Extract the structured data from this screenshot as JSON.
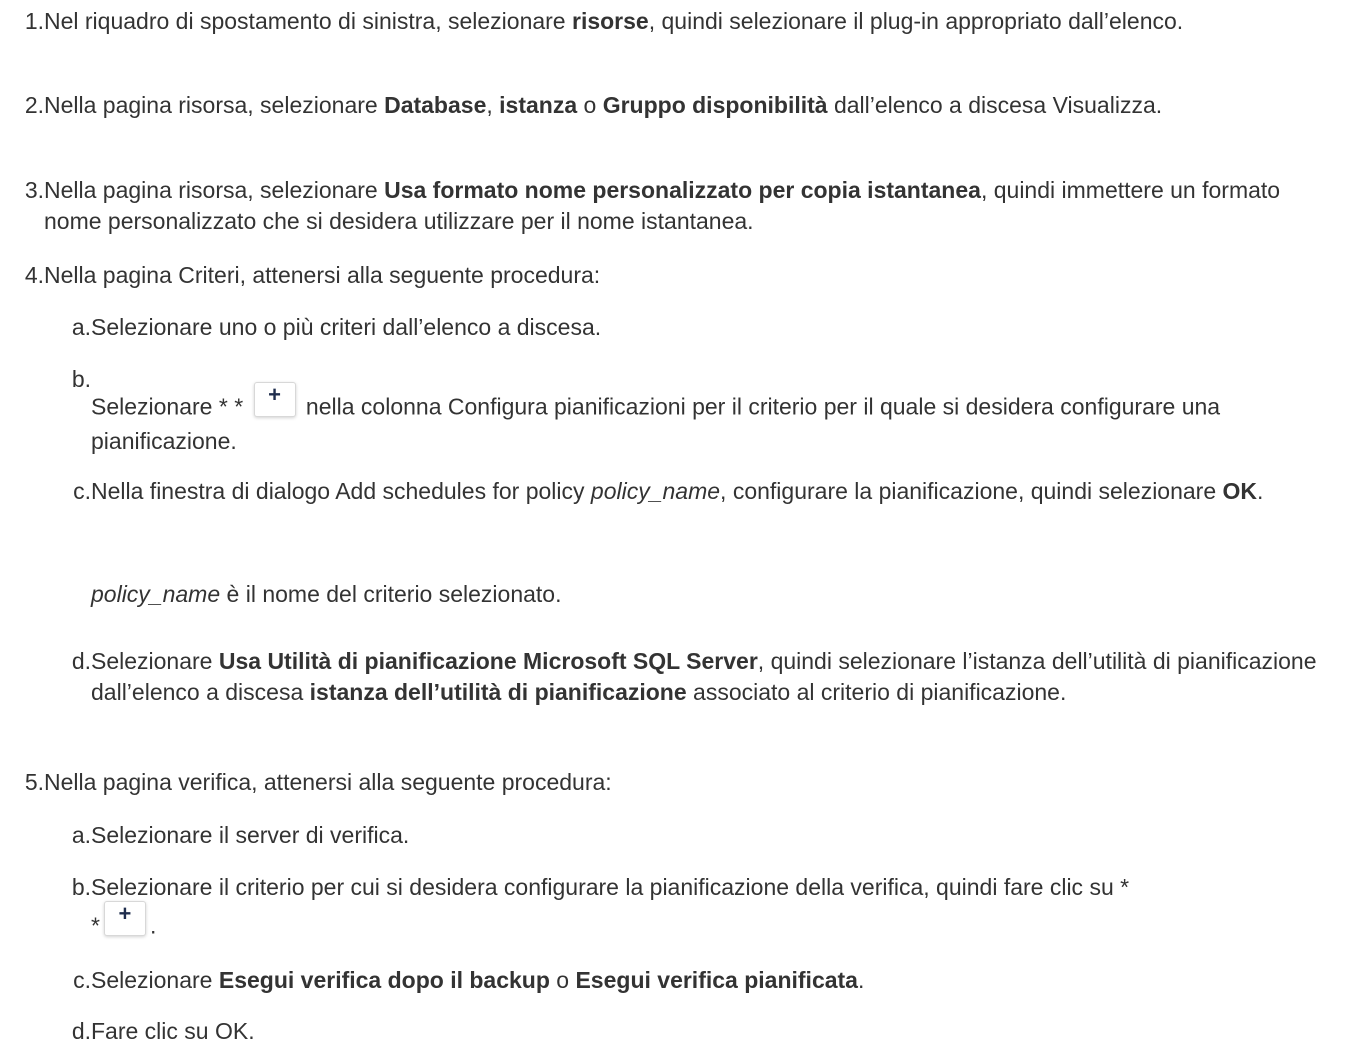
{
  "steps": [
    {
      "num": "1.",
      "parts": [
        "Nel riquadro di spostamento di sinistra, selezionare ",
        "risorse",
        ", quindi selezionare il plug-in appropriato dall’elenco."
      ]
    },
    {
      "num": "2.",
      "parts": [
        "Nella pagina risorsa, selezionare ",
        "Database",
        ", ",
        "istanza",
        " o ",
        "Gruppo disponibilità",
        " dall’elenco a discesa Visualizza."
      ]
    },
    {
      "num": "3.",
      "parts": [
        "Nella pagina risorsa, selezionare ",
        "Usa formato nome personalizzato per copia istantanea",
        ", quindi immettere un formato nome personalizzato che si desidera utilizzare per il nome istantanea."
      ]
    },
    {
      "num": "4.",
      "text": "Nella pagina Criteri, attenersi alla seguente procedura:",
      "substeps": [
        {
          "num": "a.",
          "text": "Selezionare uno o più criteri dall’elenco a discesa."
        },
        {
          "num": "b.",
          "before": "Selezionare * * ",
          "after": " nella colonna Configura pianificazioni per il criterio per il quale si desidera configurare una pianificazione."
        },
        {
          "num": "c.",
          "parts": [
            "Nella finestra di dialogo Add schedules for policy ",
            "policy_name",
            ", configurare la pianificazione, quindi selezionare ",
            "OK",
            "."
          ],
          "note": [
            "policy_name",
            " è il nome del criterio selezionato."
          ]
        },
        {
          "num": "d.",
          "parts": [
            "Selezionare ",
            "Usa Utilità di pianificazione Microsoft SQL Server",
            ", quindi selezionare l’istanza dell’utilità di pianificazione dall’elenco a discesa ",
            "istanza dell’utilità di pianificazione",
            " associato al criterio di pianificazione."
          ]
        }
      ]
    },
    {
      "num": "5.",
      "text": "Nella pagina verifica, attenersi alla seguente procedura:",
      "substeps": [
        {
          "num": "a.",
          "text": "Selezionare il server di verifica."
        },
        {
          "num": "b.",
          "text": "Selezionare il criterio per cui si desidera configurare la pianificazione della verifica, quindi fare clic su *",
          "star": "*",
          "after": "."
        },
        {
          "num": "c.",
          "parts": [
            "Selezionare ",
            "Esegui verifica dopo il backup",
            " o ",
            "Esegui verifica pianificata",
            "."
          ]
        },
        {
          "num": "d.",
          "text": "Fare clic su OK."
        }
      ]
    }
  ],
  "icons": {
    "add_button": "plus-icon",
    "add_glyph": "+"
  },
  "colors": {
    "text": "#333333",
    "icon": "#1f2d4d"
  }
}
